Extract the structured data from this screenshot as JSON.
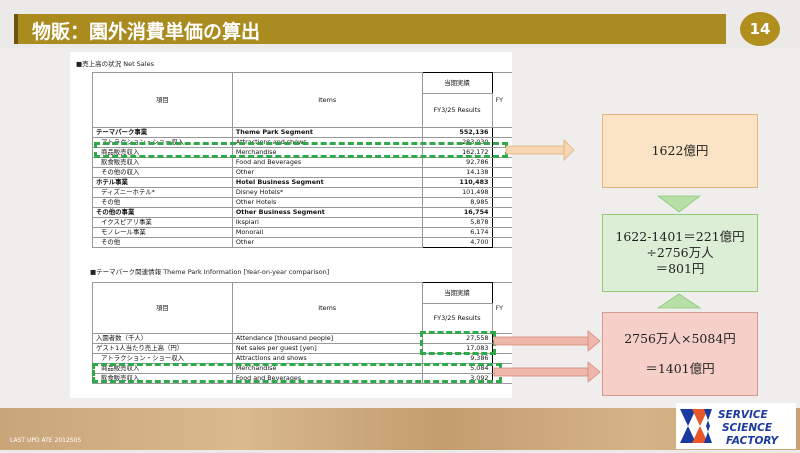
{
  "header": {
    "title": "物販：園外消費単価の算出",
    "page_number": "14"
  },
  "table1": {
    "section_title": "■売上高の状況 Net Sales",
    "col_item_ja": "項目",
    "col_item_en": "Items",
    "col_results_ja": "当期実績",
    "col_results_en": "FY3/25 Results",
    "col_next_en": "FY",
    "rows": [
      {
        "ja": "テーマパーク事業",
        "en": "Theme Park Segment",
        "value": "552,136"
      },
      {
        "ja": "アトラクション・ショー収入",
        "en": "Attractions and shows",
        "value": "283,030"
      },
      {
        "ja": "商品販売収入",
        "en": "Merchandise",
        "value": "162,172"
      },
      {
        "ja": "飲食販売収入",
        "en": "Food and Beverages",
        "value": "92,786"
      },
      {
        "ja": "その他の収入",
        "en": "Other",
        "value": "14,138"
      },
      {
        "ja": "ホテル事業",
        "en": "Hotel Business Segment",
        "value": "110,483"
      },
      {
        "ja": "ディズニーホテル*",
        "en": "Disney Hotels*",
        "value": "101,498"
      },
      {
        "ja": "その他",
        "en": "Other Hotels",
        "value": "8,985"
      },
      {
        "ja": "その他の事業",
        "en": "Other Business Segment",
        "value": "16,754"
      },
      {
        "ja": "イクスピアリ事業",
        "en": "Ikspiari",
        "value": "5,878"
      },
      {
        "ja": "モノレール事業",
        "en": "Monorail",
        "value": "6,174"
      },
      {
        "ja": "その他",
        "en": "Other",
        "value": "4,700"
      }
    ]
  },
  "table2": {
    "section_title": "■テーマパーク関連情報 Theme Park Information [Year-on-year comparison]",
    "col_item_ja": "項目",
    "col_item_en": "Items",
    "col_results_ja": "当期実績",
    "col_results_en": "FY3/25 Results",
    "col_next_en": "FY",
    "rows": [
      {
        "ja": "入園者数（千人）",
        "en": "Attendance [thousand people]",
        "value": "27,558"
      },
      {
        "ja": "ゲスト1人当たり売上高（円）",
        "en": "Net sales per guest [yen]",
        "value": "17,083"
      },
      {
        "ja": "アトラクション・ショー収入",
        "en": "Attractions and shows",
        "value": "9,386"
      },
      {
        "ja": "商品販売収入",
        "en": "Merchandise",
        "value": "5,084"
      },
      {
        "ja": "飲食販売収入",
        "en": "Food and Beverages",
        "value": "3,092"
      }
    ]
  },
  "boxes": {
    "top": "1622億円",
    "middle_line1": "1622-1401＝221億円",
    "middle_line2": "÷2756万人",
    "middle_line3": "＝801円",
    "bottom_line1": "2756万人×5084円",
    "bottom_line2": "＝1401億円"
  },
  "footer": {
    "last_update": "LAST UPD ATE 2012S05",
    "logo_line1": "SERVICE",
    "logo_line2": "SCIENCE",
    "logo_line3": "FACTORY"
  },
  "colors": {
    "header": "#a98b1f",
    "dash_green": "#2fa94a",
    "box_yellow": "#fbe4c6",
    "box_green": "#dcefd6",
    "box_red": "#f6d0c8",
    "logo_blue": "#1a3aa0"
  }
}
